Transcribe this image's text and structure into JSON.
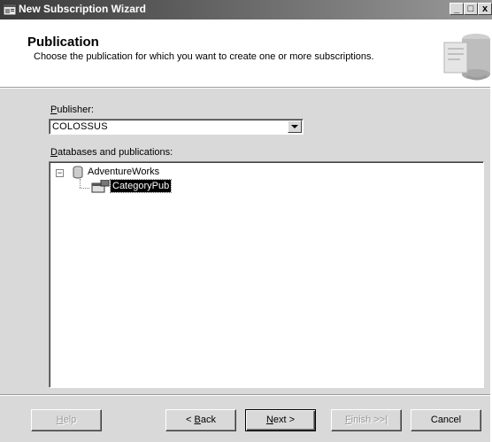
{
  "window": {
    "title": "New Subscription Wizard",
    "controls": {
      "minimize": "_",
      "maximize": "□",
      "close": "x"
    }
  },
  "header": {
    "title": "Publication",
    "subtitle": "Choose the publication for which you want to create one or more subscriptions."
  },
  "publisher": {
    "label_accel": "P",
    "label_rest": "ublisher:",
    "selected": "COLOSSUS"
  },
  "tree": {
    "label_accel": "D",
    "label_rest": "atabases and publications:",
    "expander": "−",
    "database": "AdventureWorks",
    "publication": "CategoryPub"
  },
  "buttons": {
    "help": {
      "accel": "H",
      "rest": "elp",
      "disabled": true
    },
    "back": {
      "prefix": "< ",
      "accel": "B",
      "rest": "ack"
    },
    "next": {
      "accel": "N",
      "rest": "ext >"
    },
    "finish": {
      "accel": "F",
      "rest": "inish >>|",
      "disabled": true
    },
    "cancel": {
      "label": "Cancel"
    }
  },
  "icons": {
    "app": "wizard-app-icon",
    "header": "publication-graphic-icon",
    "database": "database-icon",
    "publication": "publication-icon"
  }
}
